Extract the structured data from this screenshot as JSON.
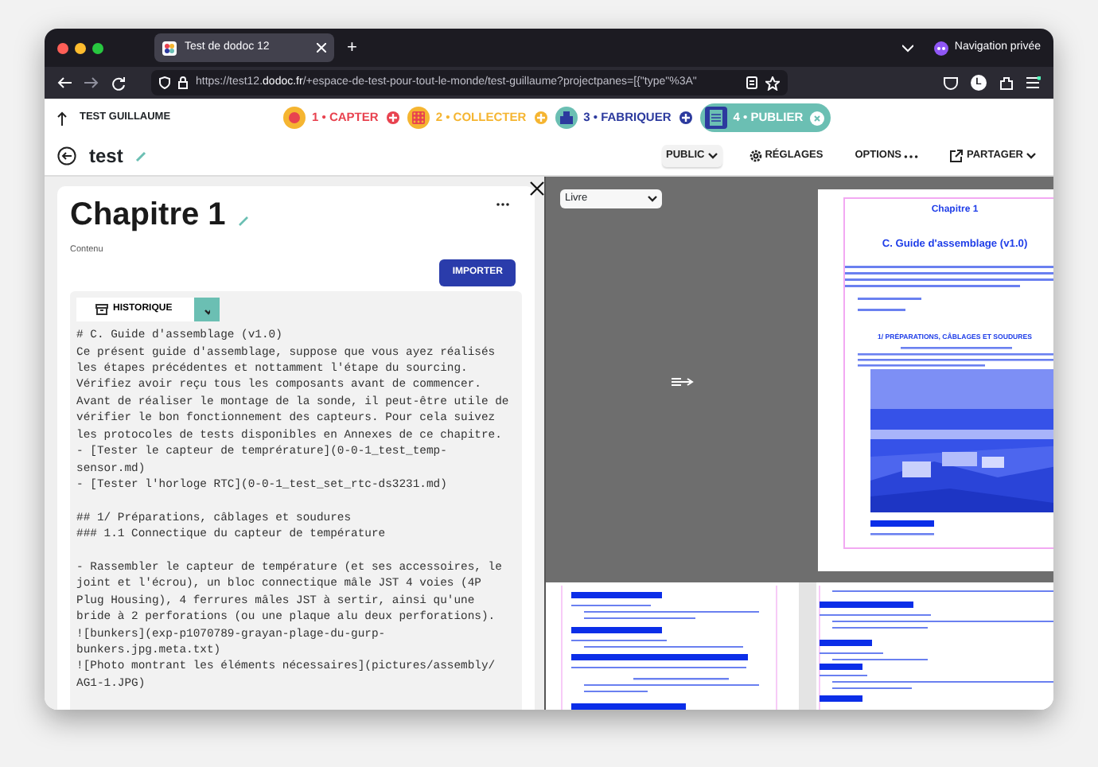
{
  "browser": {
    "tab_title": "Test de dodoc 12",
    "new_tab": "+",
    "private_label": "Navigation privée",
    "url_prefix": "https://test12.",
    "url_domain": "dodoc.fr",
    "url_path": "/+espace-de-test-pour-tout-le-monde/test-guillaume?projectpanes=[{\"type\"%3A\"",
    "profile_initial": "L"
  },
  "project": {
    "back_label": "TEST GUILLAUME",
    "title": "test"
  },
  "steps": [
    {
      "kind": "capture",
      "label": "1 • CAPTER",
      "color": "#e8424f",
      "selected": false
    },
    {
      "kind": "collect",
      "label": "2 • COLLECTER",
      "color": "#f5b531",
      "selected": false
    },
    {
      "kind": "make",
      "label": "3 • FABRIQUER",
      "color": "#2c3a9e",
      "selected": false
    },
    {
      "kind": "publish",
      "label": "4 • PUBLIER",
      "color": "#6bbfb3",
      "selected": true
    }
  ],
  "actions": [
    {
      "kind": "dropdown",
      "label": "PUBLIC"
    },
    {
      "kind": "settings",
      "label": "RÉGLAGES"
    },
    {
      "kind": "more",
      "label": "OPTIONS"
    },
    {
      "kind": "share",
      "label": "PARTAGER"
    }
  ],
  "editor": {
    "title": "Chapitre 1",
    "section_label": "Contenu",
    "import_button": "IMPORTER",
    "history_button": "HISTORIQUE",
    "validated": true,
    "blocks": [
      [
        "# C. Guide d'assemblage (v1.0)",
        "Ce présent guide d'assemblage, suppose que vous ayez réalisés",
        "les étapes précédentes et nottamment l'étape du sourcing.",
        "Vérifiez avoir reçu tous les composants avant de commencer.",
        "Avant de réaliser le montage de la sonde, il peut-être utile de",
        "vérifier le bon fonctionnement des capteurs. Pour cela suivez",
        "les protocoles de tests disponibles en Annexes de ce chapitre.",
        "- [Tester le capteur de temprérature](0-0-1_test_temp-",
        "sensor.md)",
        "- [Tester l'horloge RTC](0-0-1_test_set_rtc-ds3231.md)"
      ],
      [
        "## 1/ Préparations, câblages et soudures",
        "### 1.1 Connectique du capteur de température"
      ],
      [
        "- Rassembler le capteur de température (et ses accessoires, le",
        "joint et l'écrou), un bloc connectique mâle JST 4 voies (4P",
        "Plug Housing), 4 ferrures mâles JST à sertir, ainsi qu'une",
        "bride à 2 perforations (ou une plaque alu deux perforations).",
        "![bunkers](exp-p1070789-grayan-plage-du-gurp-",
        "bunkers.jpg.meta.txt)",
        "![Photo montrant les éléments nécessaires](pictures/assembly/",
        "AG1-1.JPG)"
      ]
    ]
  },
  "preview": {
    "view_select": "Livre",
    "chapter": "Chapitre 1",
    "heading": "C. Guide d'assemblage (v1.0)",
    "section": "1/ PRÉPARATIONS, CÂBLAGES ET SOUDURES"
  }
}
